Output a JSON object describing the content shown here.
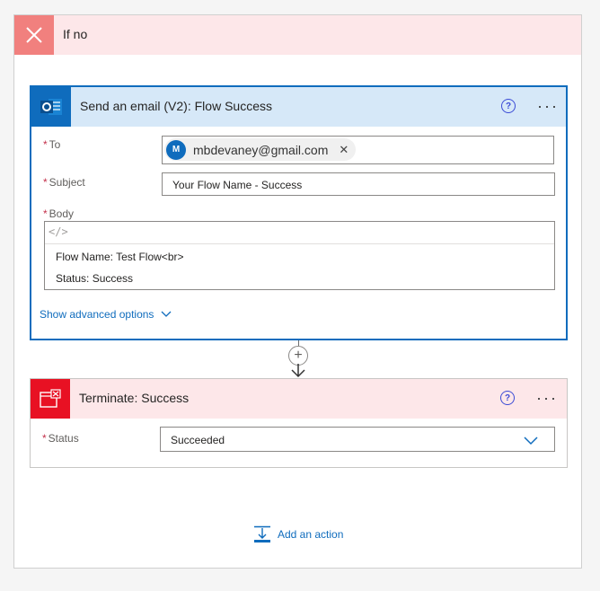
{
  "if_no": {
    "title": "If no",
    "icon": "close-icon",
    "accent": "#f1807e"
  },
  "email_action": {
    "title": "Send an email (V2): Flow Success",
    "icon": "outlook-icon",
    "to": {
      "label": "To",
      "recipient": {
        "initial": "M",
        "email": "mbdevaney@gmail.com"
      }
    },
    "subject": {
      "label": "Subject",
      "value": "Your Flow Name -  Success"
    },
    "body": {
      "label": "Body",
      "lines": [
        "Flow Name: Test Flow<br>",
        "Status: Success"
      ]
    },
    "advanced": "Show advanced options"
  },
  "terminate_action": {
    "title": "Terminate: Success",
    "icon": "terminate-icon",
    "status": {
      "label": "Status",
      "value": "Succeeded"
    }
  },
  "add_action": "Add an action",
  "required_marker": "*"
}
